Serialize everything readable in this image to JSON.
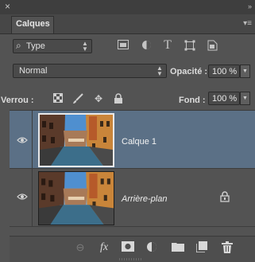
{
  "window": {
    "close_symbol": "×",
    "collapse_symbol": "»"
  },
  "tabs": [
    {
      "label": "Calques",
      "active": true
    }
  ],
  "filter": {
    "kind_label": "Type",
    "icons": [
      "image-filter-icon",
      "adjustment-filter-icon",
      "text-filter-icon",
      "shape-filter-icon",
      "smart-object-filter-icon"
    ]
  },
  "blend": {
    "mode": "Normal",
    "opacity_label": "Opacité :",
    "opacity_value": "100 %"
  },
  "lock": {
    "label": "Verrou :",
    "icons": [
      "lock-transparent-icon",
      "lock-image-icon",
      "lock-position-icon",
      "lock-all-icon"
    ]
  },
  "fill": {
    "label": "Fond :",
    "value": "100 %"
  },
  "layers": [
    {
      "name": "Calque 1",
      "visible": true,
      "selected": true,
      "locked": false
    },
    {
      "name": "Arrière-plan",
      "visible": true,
      "selected": false,
      "locked": true
    }
  ],
  "bottom_toolbar": {
    "fx_label": "fx",
    "icons": [
      "link-layers-icon",
      "fx-icon",
      "mask-icon",
      "adjustment-layer-icon",
      "new-group-icon",
      "new-layer-icon",
      "trash-icon"
    ]
  },
  "colors": {
    "panel": "#535353",
    "selected_layer": "#5b7086",
    "dark_bar": "#3e3e3e"
  }
}
